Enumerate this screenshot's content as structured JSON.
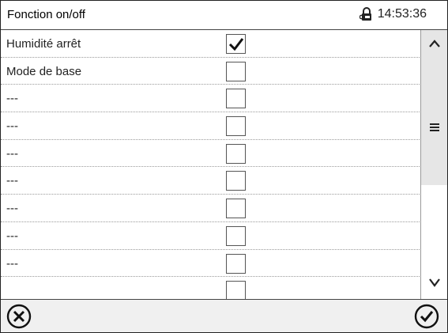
{
  "header": {
    "title": "Fonction on/off",
    "time": "14:53:36",
    "lock_icon": "padlock-key-icon"
  },
  "rows": [
    {
      "label": "Humidité arrêt",
      "checked": true
    },
    {
      "label": "Mode de base",
      "checked": false
    },
    {
      "label": "---",
      "checked": false
    },
    {
      "label": "---",
      "checked": false
    },
    {
      "label": "---",
      "checked": false
    },
    {
      "label": "---",
      "checked": false
    },
    {
      "label": "---",
      "checked": false
    },
    {
      "label": "---",
      "checked": false
    },
    {
      "label": "---",
      "checked": false
    },
    {
      "label": "",
      "checked": false
    }
  ],
  "scrollbar": {
    "up_icon": "chevron-up-icon",
    "handle_icon": "menu-lines-icon",
    "down_icon": "chevron-down-icon"
  },
  "footer": {
    "cancel_icon": "circle-x-icon",
    "confirm_icon": "circle-check-icon"
  },
  "colors": {
    "background": "#ffffff",
    "footer": "#f0f0f0",
    "scroll_track": "#e6e6e6",
    "text": "#222222"
  }
}
